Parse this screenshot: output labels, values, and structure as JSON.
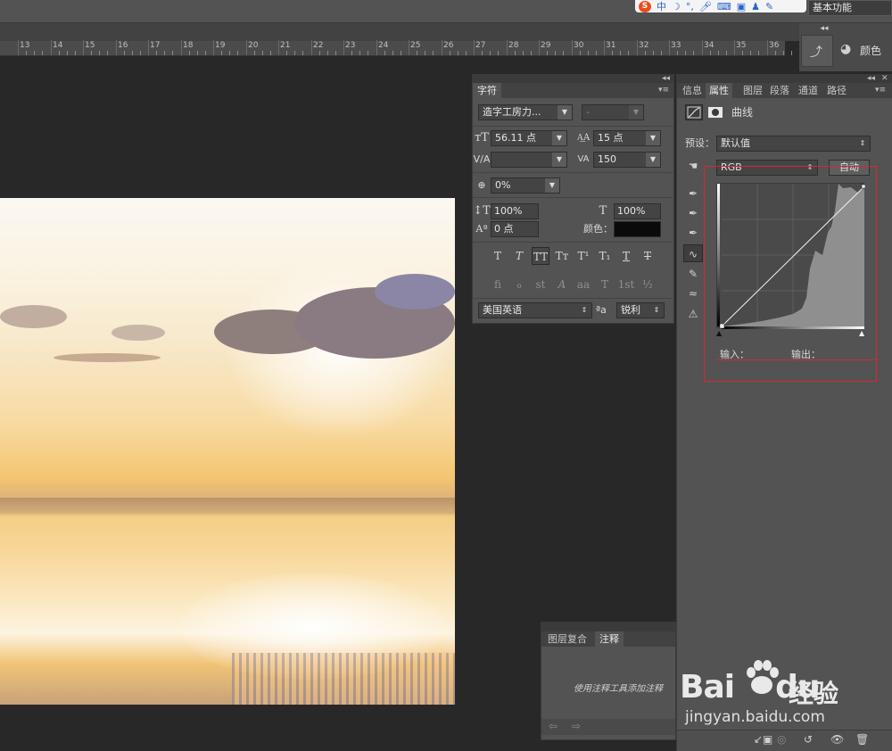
{
  "ime_bar": {
    "logo": "S",
    "label": "中",
    "icons": [
      "moon-icon",
      "comma-icon",
      "microphone-icon",
      "keyboard-icon",
      "gift-icon",
      "shirt-icon",
      "wrench-icon"
    ]
  },
  "workspace": {
    "label": "基本功能"
  },
  "ruler": {
    "numbers": [
      "13",
      "14",
      "15",
      "16",
      "17",
      "18",
      "19",
      "20",
      "21",
      "22",
      "23",
      "24",
      "25",
      "26",
      "27",
      "28",
      "29",
      "30",
      "31",
      "32",
      "33",
      "34",
      "35",
      "36"
    ]
  },
  "dock": {
    "color_label": "颜色"
  },
  "character_panel": {
    "tab": "字符",
    "font_family": "造字工房力...",
    "font_style": "-",
    "font_size": "56.11 点",
    "leading": "15 点",
    "kerning": "",
    "tracking": "150",
    "tsume": "0%",
    "vertical_scale": "100%",
    "horizontal_scale": "100%",
    "baseline_shift": "0 点",
    "color_label": "颜色：",
    "color_value": "#0a0a0a",
    "type_style_buttons": [
      "T",
      "T",
      "TT",
      "Tт",
      "T¹",
      "T₁",
      "T",
      "T"
    ],
    "opentype_buttons": [
      "fi",
      "ℴ",
      "st",
      "A",
      "aa",
      "T",
      "1st",
      "½"
    ],
    "language": "美国英语",
    "aa_label": "ªa",
    "anti_alias": "锐利"
  },
  "properties_panel": {
    "tabs": [
      "信息",
      "属性",
      "图层",
      "段落",
      "通道",
      "路径"
    ],
    "active_tab": "属性",
    "adjustment_title": "曲线",
    "preset_label": "预设：",
    "preset_value": "默认值",
    "channel": "RGB",
    "auto_button": "自动",
    "input_label": "输入：",
    "output_label": "输出："
  },
  "notes_panel": {
    "tabs": [
      "图层复合",
      "注释"
    ],
    "active_tab": "注释",
    "message": "使用注释工具添加注释"
  },
  "watermark": {
    "brand": "Bai",
    "brand2": "du",
    "cn": "经验",
    "url": "jingyan.baidu.com"
  }
}
